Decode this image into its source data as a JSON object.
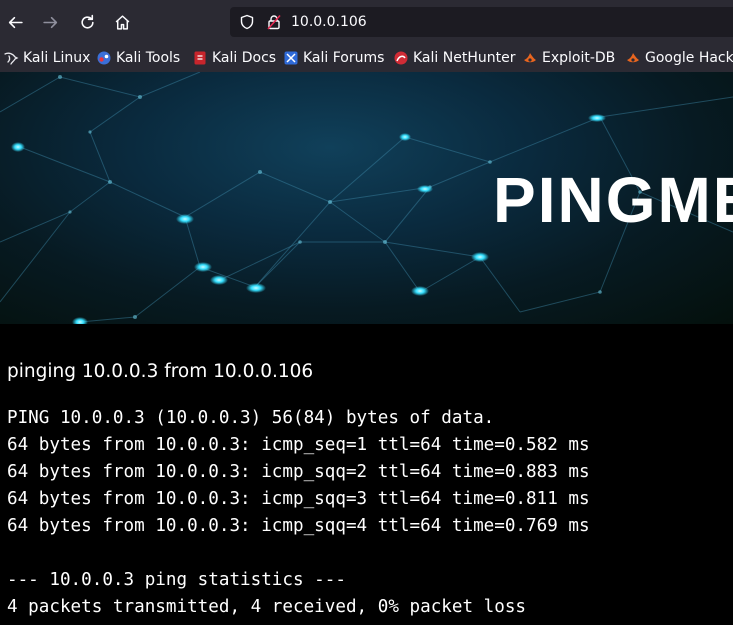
{
  "browser": {
    "url": "10.0.0.106"
  },
  "bookmarks": [
    {
      "label": "Kali Linux",
      "icon": "kali-dragon-icon"
    },
    {
      "label": "Kali Tools",
      "icon": "kali-tools-icon"
    },
    {
      "label": "Kali Docs",
      "icon": "kali-docs-icon"
    },
    {
      "label": "Kali Forums",
      "icon": "kali-forums-icon"
    },
    {
      "label": "Kali NetHunter",
      "icon": "kali-nethunter-icon"
    },
    {
      "label": "Exploit-DB",
      "icon": "exploit-db-icon"
    },
    {
      "label": "Google Hacking",
      "icon": "ghdb-icon"
    }
  ],
  "hero": {
    "title": "PINGME"
  },
  "content": {
    "heading": "pinging 10.0.0.3 from 10.0.0.106",
    "output_lines": [
      "PING 10.0.0.3 (10.0.0.3) 56(84) bytes of data.",
      "64 bytes from 10.0.0.3: icmp_seq=1 ttl=64 time=0.582 ms",
      "64 bytes from 10.0.0.3: icmp_sqq=2 ttl=64 time=0.883 ms",
      "64 bytes from 10.0.0.3: icmp_sqq=3 ttl=64 time=0.811 ms",
      "64 bytes from 10.0.0.3: icmp_sqq=4 ttl=64 time=0.769 ms",
      "",
      "--- 10.0.0.3 ping statistics ---",
      "4 packets transmitted, 4 received, 0% packet loss"
    ]
  },
  "colors": {
    "toolbar_bg": "#2b2a33",
    "urlbar_bg": "#1c1b22",
    "page_bg": "#000000",
    "node_cyan": "#35e0ff"
  }
}
